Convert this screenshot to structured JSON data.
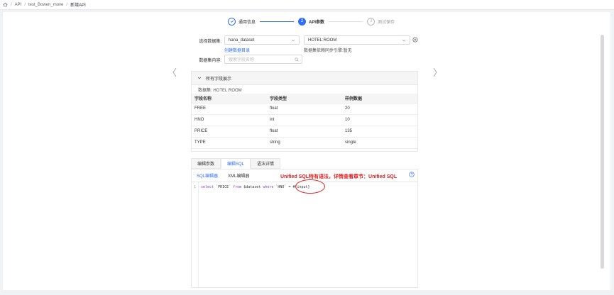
{
  "breadcrumb": {
    "items": [
      "API",
      "test_Bowen_move"
    ],
    "current": "新增API"
  },
  "steps": [
    {
      "number": "✓",
      "label": "通用信息",
      "state": "done"
    },
    {
      "number": "2",
      "label": "API参数",
      "state": "active"
    },
    {
      "number": "3",
      "label": "测试保存",
      "state": "todo"
    }
  ],
  "form": {
    "dataset_label": "选择数据集:",
    "dataset_value": "hana_dataset",
    "table_value": "HOTEL:ROOM",
    "create_dir_link": "创建数据目录",
    "sync_hint": "数据集依赖同步引擎:暂无",
    "content_label": "数据集内容:",
    "search_placeholder": "搜索字段名称"
  },
  "fields": {
    "header": "所有字段展示",
    "dataset_line": "数据集: HOTEL:ROOM",
    "columns": [
      "字段名称",
      "字段类型",
      "样例数据"
    ],
    "rows": [
      [
        "FREE",
        "float",
        "20"
      ],
      [
        "HNO",
        "int",
        "10"
      ],
      [
        "PRICE",
        "float",
        "135"
      ],
      [
        "TYPE",
        "string",
        "single"
      ]
    ]
  },
  "tabs": [
    "编辑参数",
    "编辑SQL",
    "语法详情"
  ],
  "editor": {
    "subtabs": [
      "SQL编辑器",
      "XML编辑器"
    ],
    "note": "Unified SQL特有语法，详情查看章节：Unified SQL",
    "line_number": "1",
    "code": {
      "kw_select": "select",
      "col": " `PRICE` ",
      "kw_from": "from",
      "table": " $dataset ",
      "kw_where": "where",
      "cond": " `HNO` = ",
      "param": "#{input}"
    }
  },
  "colors": {
    "accent": "#2f6ef5",
    "annotation": "#e02020"
  }
}
